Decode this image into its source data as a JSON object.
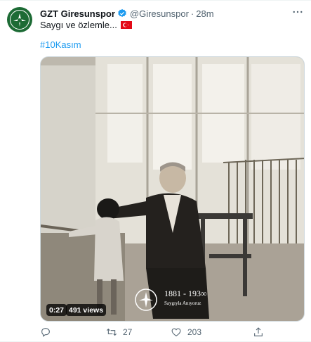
{
  "tweet": {
    "author_name": "GZT Giresunspor",
    "handle": "@Giresunspor",
    "separator": "·",
    "time": "28m",
    "text": "Saygı ve özlemle...",
    "flag_icon": "turkey-flag-icon",
    "hashtag": "#10Kasım",
    "verified_icon": "verified-badge-icon",
    "avatar_icon": "giresunspor-logo",
    "more_icon": "more-horizontal-icon"
  },
  "video": {
    "elapsed": "0:27",
    "views": "491 views",
    "overlay_year": "1881 - 193∞",
    "overlay_caption": "Saygıyla Anıyoruz",
    "overlay_logo": "giresunspor-seal"
  },
  "actions": {
    "reply_icon": "reply-icon",
    "retweet_icon": "retweet-icon",
    "retweet_count": "27",
    "like_icon": "heart-icon",
    "like_count": "203",
    "share_icon": "share-icon"
  },
  "colors": {
    "accent": "#1d9bf0",
    "secondary_text": "#536471",
    "brand_green": "#1d6b35"
  }
}
